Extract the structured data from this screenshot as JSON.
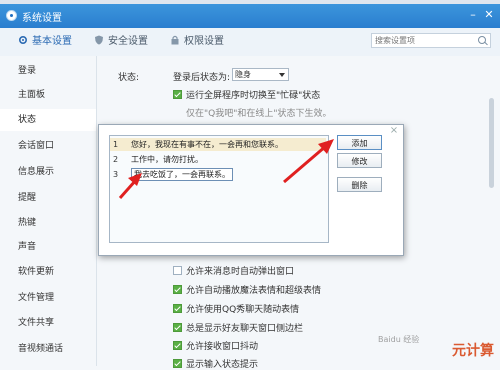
{
  "window": {
    "title": "系统设置"
  },
  "toolbar": {
    "tabs": [
      {
        "label": "基本设置",
        "icon": "gear-icon"
      },
      {
        "label": "安全设置",
        "icon": "shield-icon"
      },
      {
        "label": "权限设置",
        "icon": "lock-icon"
      }
    ],
    "search_placeholder": "搜索设置项"
  },
  "sidebar": {
    "items": [
      {
        "label": "登录"
      },
      {
        "label": "主面板"
      },
      {
        "label": "状态"
      },
      {
        "label": "会话窗口"
      },
      {
        "label": "信息展示"
      },
      {
        "label": "提醒"
      },
      {
        "label": "热键"
      },
      {
        "label": "声音"
      },
      {
        "label": "软件更新"
      },
      {
        "label": "文件管理"
      },
      {
        "label": "文件共享"
      },
      {
        "label": "音视频通话"
      }
    ],
    "active_index": 2
  },
  "status": {
    "section_label": "状态:",
    "login_label": "登录后状态为:",
    "login_value": "隐身",
    "busy_option": "运行全屏程序时切换至\"忙碌\"状态",
    "partial_text": "仅在\"Q我吧\"和在线上\"状态下生效。"
  },
  "options": [
    {
      "label": "允许来消息时自动弹出窗口",
      "checked": false
    },
    {
      "label": "允许自动播放魔法表情和超级表情",
      "checked": true
    },
    {
      "label": "允许使用QQ秀聊天随动表情",
      "checked": true
    },
    {
      "label": "总是显示好友聊天窗口侧边栏",
      "checked": true
    },
    {
      "label": "允许接收窗口抖动",
      "checked": true
    },
    {
      "label": "显示输入状态提示",
      "checked": true
    }
  ],
  "popup": {
    "items": [
      {
        "num": "1",
        "text": "您好，我现在有事不在，一会再和您联系。"
      },
      {
        "num": "2",
        "text": "工作中，请勿打扰。"
      },
      {
        "num": "3",
        "text": "我去吃饭了，一会再联系。"
      }
    ],
    "selected_index": 0,
    "buttons": {
      "add": "添加",
      "edit": "修改",
      "delete": "删除"
    }
  },
  "watermark": {
    "text": "元计算",
    "sub": "Baidu 经验"
  },
  "colors": {
    "titlebar": "#2a7ecf",
    "accent_arrow": "#e02020",
    "checkbox_on": "#5ab045"
  }
}
